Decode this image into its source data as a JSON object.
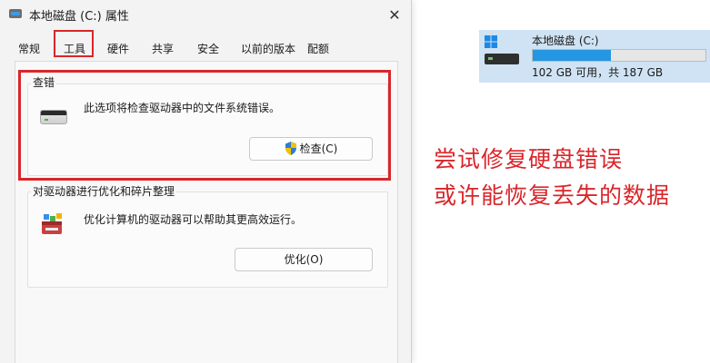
{
  "dialog": {
    "title": "本地磁盘 (C:) 属性",
    "close_glyph": "✕",
    "tabs": [
      {
        "label": "常规"
      },
      {
        "label": "工具"
      },
      {
        "label": "硬件"
      },
      {
        "label": "共享"
      },
      {
        "label": "安全"
      },
      {
        "label": "以前的版本"
      },
      {
        "label": "配额"
      }
    ],
    "active_tab": "工具",
    "error_check": {
      "title": "查错",
      "description": "此选项将检查驱动器中的文件系统错误。",
      "button_label": "检查(C)"
    },
    "optimize": {
      "title": "对驱动器进行优化和碎片整理",
      "description": "优化计算机的驱动器可以帮助其更高效运行。",
      "button_label": "优化(O)"
    }
  },
  "drive_tile": {
    "name": "本地磁盘 (C:)",
    "usage_text": "102 GB 可用，共 187 GB",
    "used_fraction": 0.455
  },
  "annotation": {
    "line1": "尝试修复硬盘错误",
    "line2": "或许能恢复丢失的数据"
  },
  "colors": {
    "highlight_red": "#d9262b",
    "bar_blue": "#2596e1",
    "tile_bg": "#cfe3f4"
  }
}
